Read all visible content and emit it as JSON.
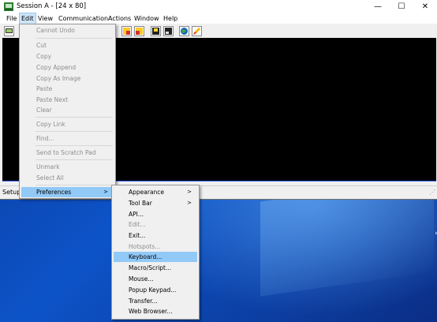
{
  "window": {
    "title": "Session A - [24 x 80]"
  },
  "caption": {
    "minimize": "—",
    "maximize": "☐",
    "close": "✕"
  },
  "menubar": [
    "File",
    "Edit",
    "View",
    "Communication",
    "Actions",
    "Window",
    "Help"
  ],
  "status": {
    "text": "Setup"
  },
  "edit_menu": {
    "items": [
      "Cannot Undo",
      "Cut",
      "Copy",
      "Copy Append",
      "Copy As Image",
      "Paste",
      "Paste Next",
      "Clear",
      "Copy Link",
      "Find...",
      "Send to Scratch Pad",
      "Unmark",
      "Select All",
      "Preferences"
    ]
  },
  "preferences_menu": {
    "items": [
      "Appearance",
      "Tool Bar",
      "API...",
      "Edit...",
      "Exit...",
      "Hotspots...",
      "Keyboard...",
      "Macro/Script...",
      "Mouse...",
      "Popup Keypad...",
      "Transfer...",
      "Web Browser..."
    ]
  },
  "icons": {
    "submenu_arrow": ">"
  },
  "colors": {
    "menu_highlight": "#91c9f7",
    "active_menu": "#cce4f7",
    "terminal_bg": "#000000"
  }
}
